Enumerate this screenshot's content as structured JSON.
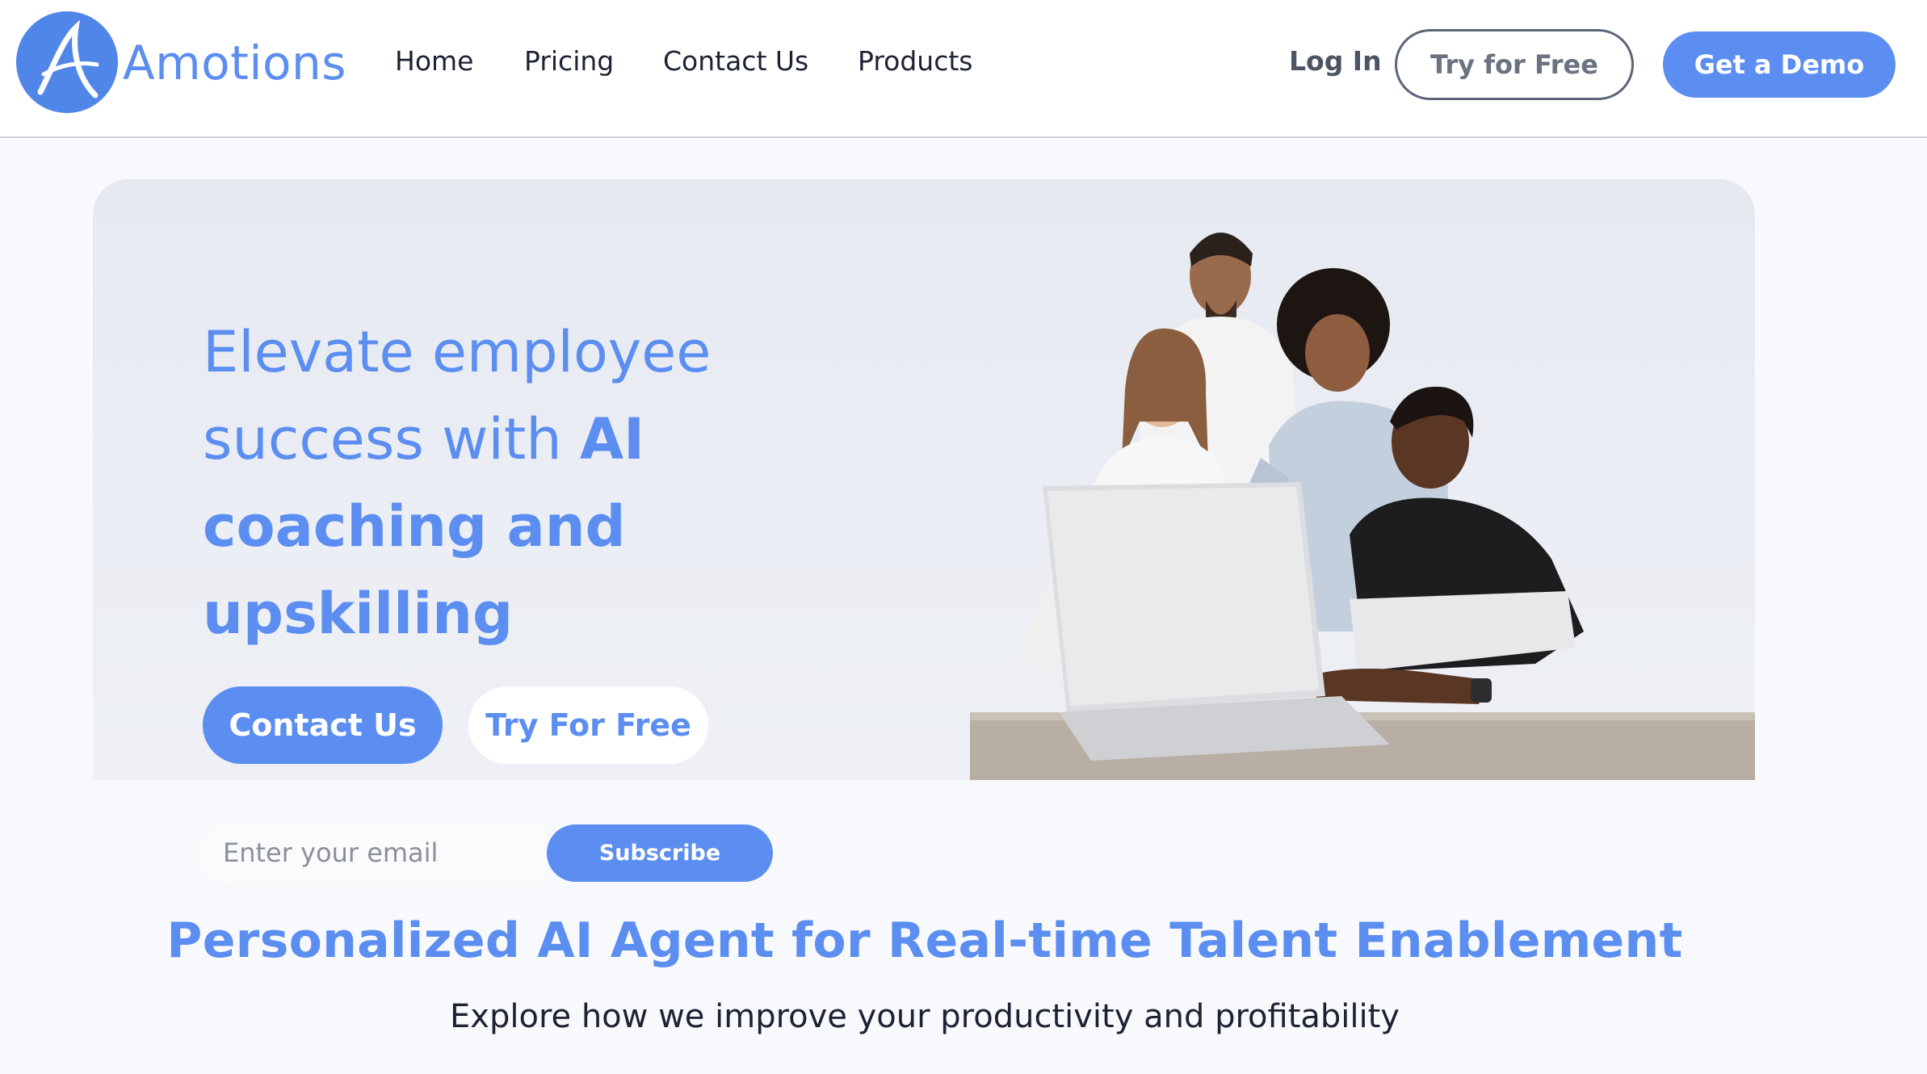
{
  "header": {
    "brand": "Amotions",
    "nav": [
      "Home",
      "Pricing",
      "Contact Us",
      "Products"
    ],
    "login": "Log In",
    "try_free": "Try for Free",
    "demo": "Get a Demo"
  },
  "hero": {
    "headline_regular": "Elevate employee success with ",
    "headline_bold": "AI coaching and upskilling",
    "contact_button": "Contact Us",
    "try_button": "Try For Free"
  },
  "subscribe": {
    "placeholder": "Enter your email",
    "button": "Subscribe"
  },
  "section": {
    "heading": "Personalized AI Agent for Real-time Talent Enablement",
    "subtext": "Explore how we improve your productivity and profitability"
  },
  "colors": {
    "accent": "#5b8ef0",
    "text_dark": "#1d2233"
  },
  "icons": {
    "logo": "amotions-a-logo-icon"
  }
}
